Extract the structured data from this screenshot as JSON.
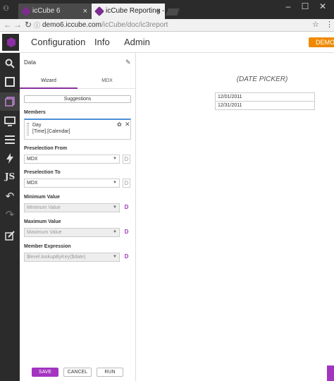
{
  "browser": {
    "tabs": [
      {
        "title": "icCube 6",
        "close": "×"
      },
      {
        "title": "icCube Reporting - mak",
        "close": "×"
      }
    ],
    "window_controls": [
      "–",
      "☐",
      "✕"
    ],
    "url_host": "demo6.iccube.com",
    "url_path": "/icCube/doc/ic3report"
  },
  "header": {
    "menus": [
      "Configuration",
      "Info",
      "Admin"
    ],
    "demo_button": "DEMO"
  },
  "sidebar_icons": [
    "search-icon",
    "square-icon",
    "cube-icon",
    "monitor-icon",
    "menu-icon",
    "bolt-icon",
    "js-icon",
    "undo-icon",
    "redo-icon",
    "edit-icon"
  ],
  "sidebar_js_label": "JS",
  "panel": {
    "title": "Data",
    "tabs": [
      "Wizard",
      "MDX"
    ],
    "suggestions_label": "Suggestions",
    "members_label": "Members",
    "member_line1": "Day",
    "member_line2": "[Time].[Calendar]",
    "fields": [
      {
        "label": "Preselection From",
        "value": "MDX",
        "disabled": false,
        "d": "D"
      },
      {
        "label": "Preselection To",
        "value": "MDX",
        "disabled": false,
        "d": "D"
      },
      {
        "label": "Minimum Value",
        "value": "Minimum Value",
        "disabled": true,
        "d": "D"
      },
      {
        "label": "Maximum Value",
        "value": "Maximum Value",
        "disabled": true,
        "d": "D"
      },
      {
        "label": "Member Expression",
        "value": "$level.lookupByKey($date)",
        "disabled": true,
        "d": "D"
      }
    ],
    "buttons": {
      "save": "SAVE",
      "cancel": "CANCEL",
      "run": "RUN"
    }
  },
  "canvas": {
    "title": "(DATE PICKER)",
    "date_from": "12/01/2011",
    "date_to": "12/31/2011"
  }
}
